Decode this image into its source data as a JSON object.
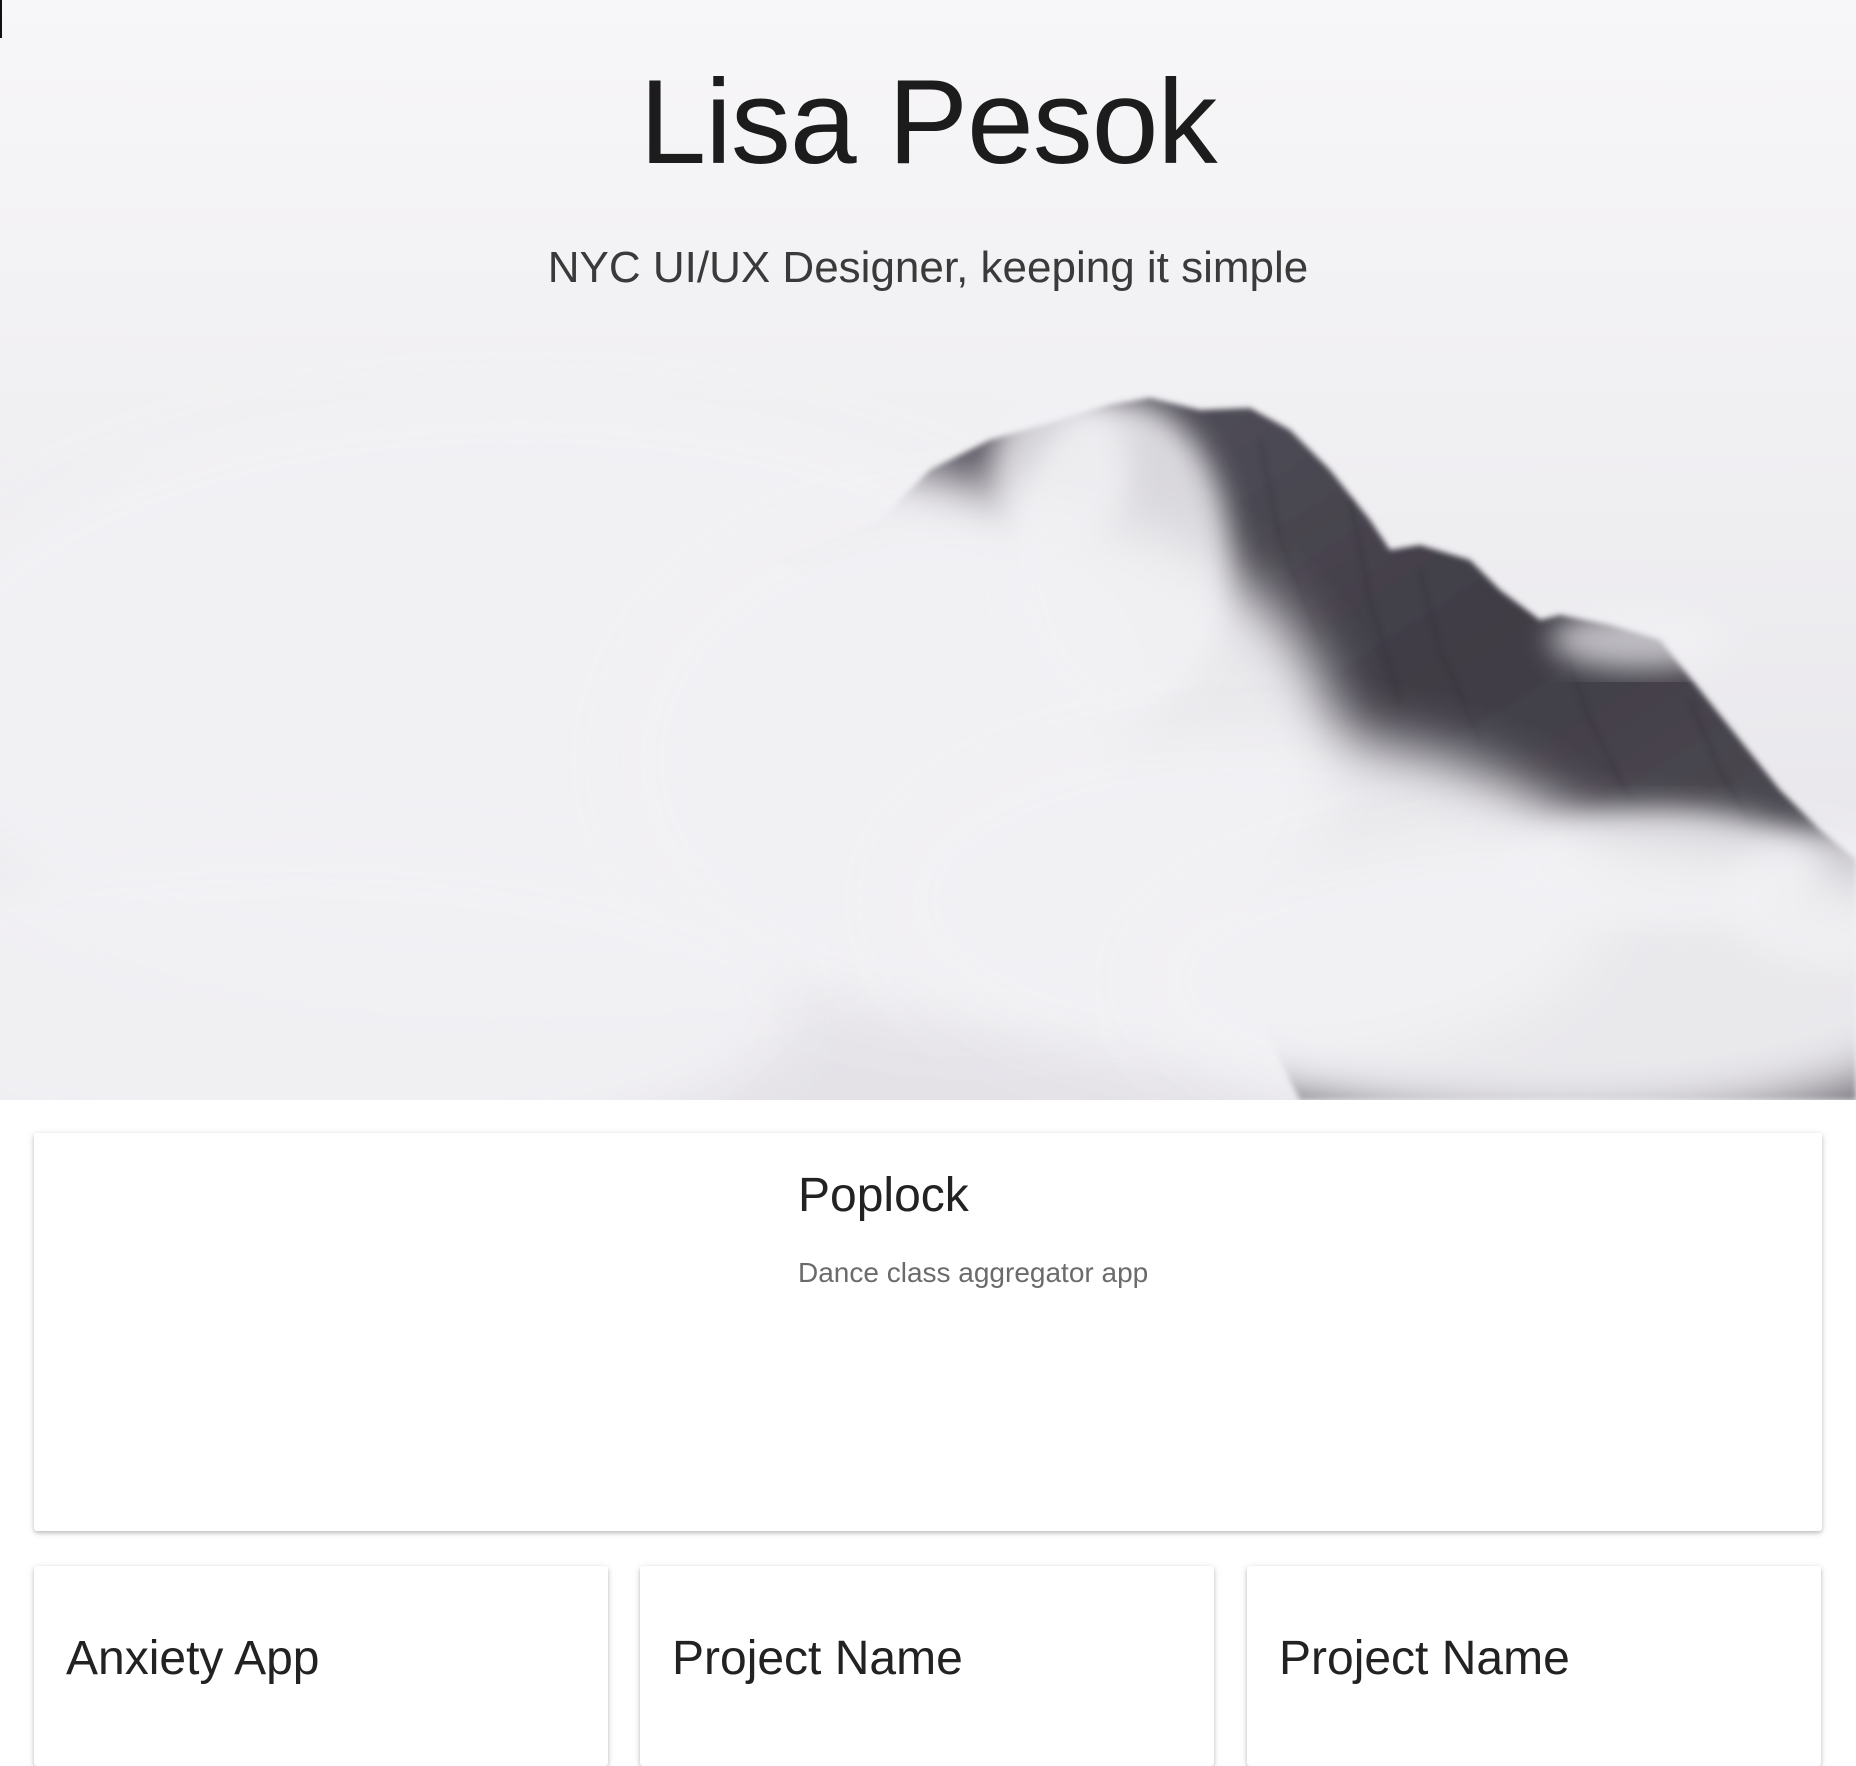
{
  "hero": {
    "title": "Lisa Pesok",
    "subtitle": "NYC UI/UX Designer, keeping it simple"
  },
  "featured_project": {
    "title": "Poplock",
    "description": "Dance class aggregator app"
  },
  "projects": [
    {
      "title": "Anxiety App"
    },
    {
      "title": "Project Name"
    },
    {
      "title": "Project Name"
    }
  ],
  "colors": {
    "background": "#ffffff",
    "text_primary": "#222222",
    "text_secondary": "#6b6b6b",
    "sky": "#eeedef",
    "mountain": "#4a4850"
  }
}
